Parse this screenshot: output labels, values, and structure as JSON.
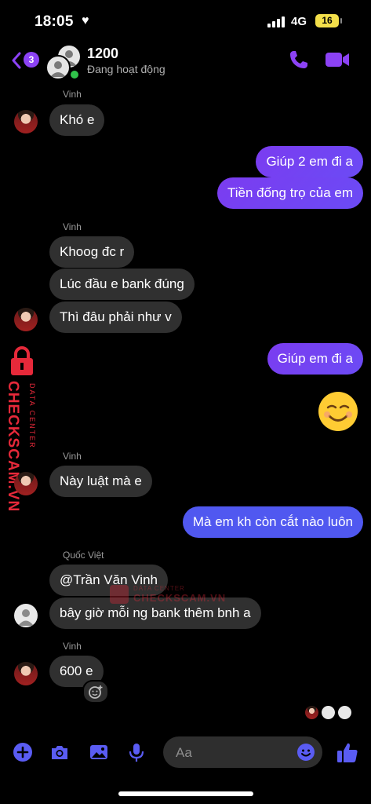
{
  "status_bar": {
    "time": "18:05",
    "network": "4G",
    "battery": "16"
  },
  "header": {
    "back_count": "3",
    "title": "1200",
    "status": "Đang hoạt động"
  },
  "messages": [
    {
      "sender": "Vinh",
      "text": "Khó e"
    },
    {
      "text": "Giúp 2 em đi a"
    },
    {
      "text": "Tiền đống trọ của em"
    },
    {
      "sender": "Vinh",
      "text": "Khoog đc r"
    },
    {
      "text": "Lúc đầu e bank đúng"
    },
    {
      "text": "Thì đâu phải như v"
    },
    {
      "text": "Giúp em đi a"
    },
    {
      "sender": "Vinh",
      "text": "Này luật mà e"
    },
    {
      "text": "Mà em kh còn cắt nào luôn"
    },
    {
      "sender": "Quốc Việt",
      "text": "@Trần Văn Vinh"
    },
    {
      "text": "bây giờ mỗi ng bank thêm bnh a"
    },
    {
      "sender": "Vinh",
      "text": "600 e"
    }
  ],
  "composer": {
    "placeholder": "Aa"
  },
  "watermark": {
    "brand": "CHECKSCAM.VN",
    "tagline": "DATA CENTER"
  },
  "colors": {
    "accent": "#8c42f5",
    "outgoing": "#7b3cf0",
    "outgoing_blue": "#5058f0",
    "incoming": "#303030",
    "online": "#30c34a",
    "watermark": "#e6293a"
  }
}
